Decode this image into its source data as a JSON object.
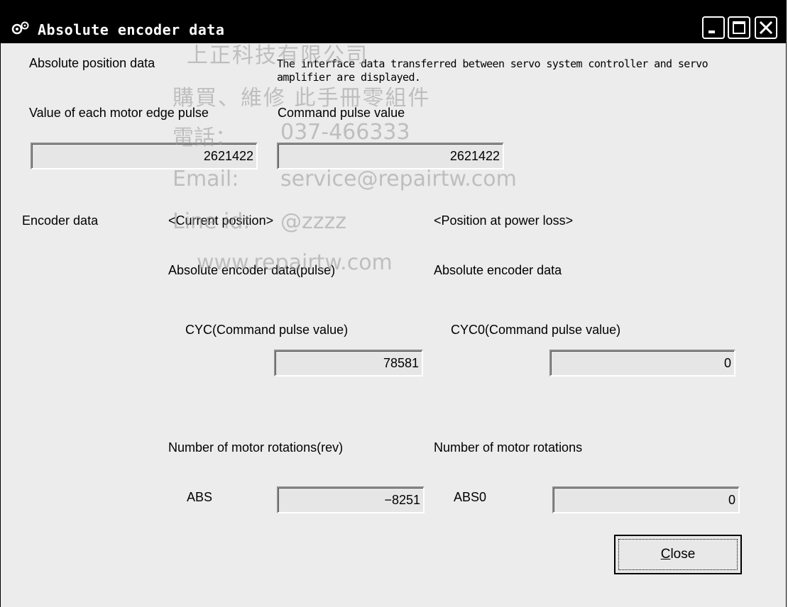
{
  "window": {
    "title": "Absolute encoder data",
    "icon": "app-gear-icon",
    "controls": {
      "minimize": "minimize-icon",
      "maximize": "maximize-icon",
      "close": "close-icon"
    }
  },
  "absolute_position": {
    "label": "Absolute position data",
    "note_line1": "The interface data transferred between servo system controller and servo",
    "note_line2": "amplifier are displayed.",
    "motor_edge_label": "Value of each motor edge pulse",
    "motor_edge_value": "2621422",
    "command_pulse_label": "Command pulse value",
    "command_pulse_value": "2621422"
  },
  "encoder": {
    "label": "Encoder data",
    "current_header": "<Current position>",
    "power_loss_header": "<Position at power loss>",
    "current_sub": "Absolute encoder data(pulse)",
    "power_loss_sub": "Absolute encoder data",
    "cyc_label": "CYC(Command pulse value)",
    "cyc_value": "78581",
    "cyc0_label": "CYC0(Command pulse value)",
    "cyc0_value": "0",
    "rotations_label": "Number of motor rotations(rev)",
    "rotations0_label": "Number of motor rotations",
    "abs_label": "ABS",
    "abs_value": "−8251",
    "abs0_label": "ABS0",
    "abs0_value": "0"
  },
  "buttons": {
    "close_mnemonic": "C",
    "close_rest": "lose"
  },
  "watermark": {
    "company": "上正科技有限公司",
    "service": "購買、維修 此手冊零組件",
    "phone_label": "電話：",
    "phone": "037-466333",
    "email_label": "Email:",
    "email": "service@repairtw.com",
    "line_label": "Line id:",
    "line_id": "@zzzz",
    "website": "www.repairtw.com"
  }
}
